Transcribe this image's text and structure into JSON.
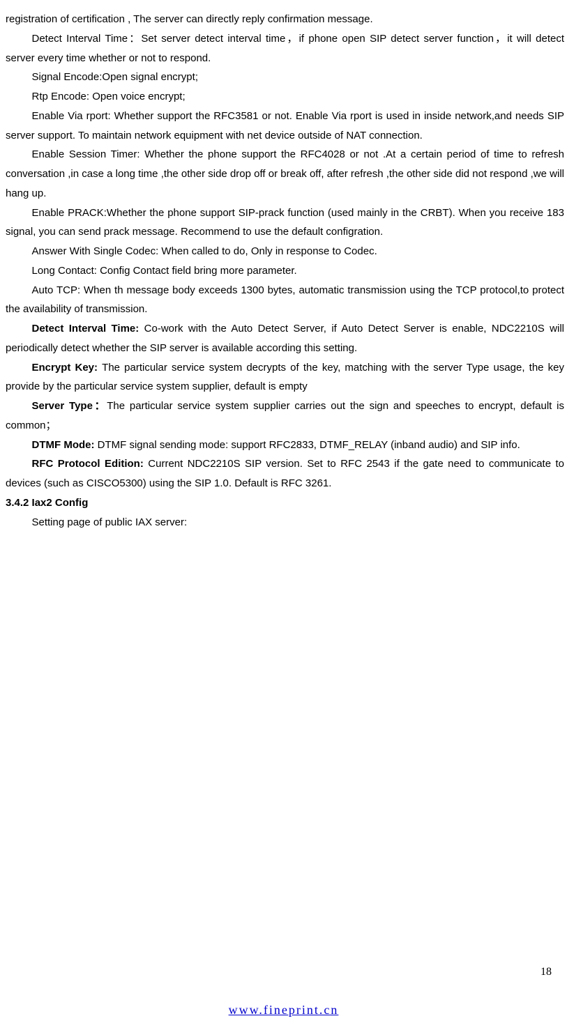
{
  "paragraphs": [
    {
      "cls": "para-first",
      "text": "registration of certification , The server can directly reply confirmation message."
    },
    {
      "cls": "para",
      "text": "Detect Interval Time：Set server detect interval time，if phone open SIP detect server function，it will detect server every time whether or not to respond."
    },
    {
      "cls": "para",
      "text": "Signal Encode:Open signal encrypt;"
    },
    {
      "cls": "para",
      "text": "Rtp Encode: Open voice encrypt;"
    },
    {
      "cls": "para",
      "text": "Enable Via rport: Whether support the RFC3581 or not. Enable Via rport is used in inside network,and needs SIP server support. To maintain network equipment with net device outside of NAT connection."
    },
    {
      "cls": "para",
      "text": "Enable Session Timer: Whether the phone support the RFC4028 or not .At a certain period of time to refresh conversation ,in case a long time ,the other side drop off or break off, after refresh ,the other side did not respond ,we will hang up."
    },
    {
      "cls": "para",
      "text": "Enable PRACK:Whether the phone support SIP-prack function (used mainly in the CRBT). When you receive 183 signal, you can send prack message. Recommend to use the default configration."
    },
    {
      "cls": "para",
      "text": "Answer With Single Codec: When called to do, Only in response to Codec."
    },
    {
      "cls": "para",
      "text": "Long Contact: Config Contact field bring more parameter."
    },
    {
      "cls": "para",
      "text": "Auto TCP: When th message body exceeds 1300 bytes, automatic transmission using the TCP protocol,to protect the availability of transmission."
    },
    {
      "cls": "para",
      "bold_prefix": "Detect Interval Time: ",
      "text": "Co-work with the Auto Detect Server, if Auto Detect Server is enable, NDC2210S will periodically detect whether the SIP server is available according this setting."
    },
    {
      "cls": "para",
      "bold_prefix": "Encrypt Key: ",
      "text": "The particular service system decrypts of the key, matching with the server Type usage, the key provide by the particular service system supplier, default is empty"
    },
    {
      "cls": "para",
      "bold_prefix": " Server Type：",
      "text": "The particular service system supplier carries out the sign and speeches to encrypt, default is common；"
    },
    {
      "cls": "para",
      "bold_prefix": "DTMF Mode: ",
      "text": "DTMF signal sending mode: support RFC2833, DTMF_RELAY (inband audio) and SIP info."
    },
    {
      "cls": "para",
      "bold_prefix": "RFC Protocol Edition: ",
      "text": "Current NDC2210S SIP version. Set to RFC 2543 if the gate need to communicate to devices (such as CISCO5300) using the SIP 1.0. Default is RFC 3261."
    }
  ],
  "section_heading": "3.4.2 Iax2 Config",
  "section_body": "Setting page of public IAX server:",
  "page_number": "18",
  "footer_url_text": "www.fineprint.cn"
}
